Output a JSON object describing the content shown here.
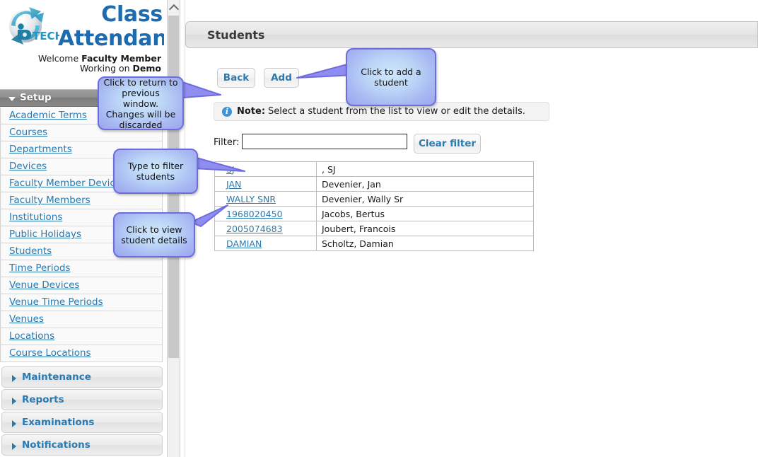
{
  "brand": {
    "logo_icon": "ip-tech-globe-logo",
    "logo_text": "TECH",
    "title": "Class Attendance",
    "welcome_prefix": "Welcome ",
    "welcome_user": "Faculty Member",
    "working_prefix": "Working on ",
    "working_context": "Demo"
  },
  "sidebar": {
    "groups": [
      {
        "label": "Setup",
        "expanded": true,
        "icon": "chevron-down-icon",
        "items": [
          {
            "label": "Academic Terms"
          },
          {
            "label": "Courses"
          },
          {
            "label": "Departments"
          },
          {
            "label": "Devices"
          },
          {
            "label": "Faculty Member Devices"
          },
          {
            "label": "Faculty Members"
          },
          {
            "label": "Institutions"
          },
          {
            "label": "Public Holidays"
          },
          {
            "label": "Students"
          },
          {
            "label": "Time Periods"
          },
          {
            "label": "Venue Devices"
          },
          {
            "label": "Venue Time Periods"
          },
          {
            "label": "Venues"
          },
          {
            "label": "Locations"
          },
          {
            "label": "Course Locations"
          }
        ]
      },
      {
        "label": "Maintenance",
        "expanded": false,
        "icon": "chevron-right-icon"
      },
      {
        "label": "Reports",
        "expanded": false,
        "icon": "chevron-right-icon"
      },
      {
        "label": "Examinations",
        "expanded": false,
        "icon": "chevron-right-icon"
      },
      {
        "label": "Notifications",
        "expanded": false,
        "icon": "chevron-right-icon"
      }
    ]
  },
  "scrollbar": {
    "up_icon": "chevron-up-icon"
  },
  "main": {
    "page_title": "Students",
    "buttons": {
      "back": "Back",
      "add": "Add",
      "clear_filter": "Clear filter"
    },
    "note": {
      "icon": "info-icon",
      "label": "Note:",
      "text": "Select a student from the list to view or edit the details."
    },
    "filter": {
      "label": "Filter:",
      "value": "",
      "placeholder": ""
    },
    "table": {
      "rows": [
        {
          "code": "SJ",
          "name": ", SJ"
        },
        {
          "code": "JAN",
          "name": "Devenier, Jan"
        },
        {
          "code": "WALLY SNR",
          "name": "Devenier, Wally Sr"
        },
        {
          "code": "1968020450",
          "name": "Jacobs, Bertus"
        },
        {
          "code": "2005074683",
          "name": "Joubert, Francois"
        },
        {
          "code": "DAMIAN",
          "name": "Scholtz, Damian"
        }
      ]
    }
  },
  "callouts": {
    "back": "Click to return to previous window. Changes will be discarded",
    "add": "Click to add a student",
    "filter": "Type to filter students",
    "detail": "Click to view student details"
  },
  "colors": {
    "brand_blue": "#1f6bb0",
    "link_blue": "#2a7ab0",
    "callout_border": "#6f6ce0",
    "callout_fill": "#bcd6f7",
    "info_icon": "#3f93d6",
    "group_header": "#8f8f8f"
  }
}
